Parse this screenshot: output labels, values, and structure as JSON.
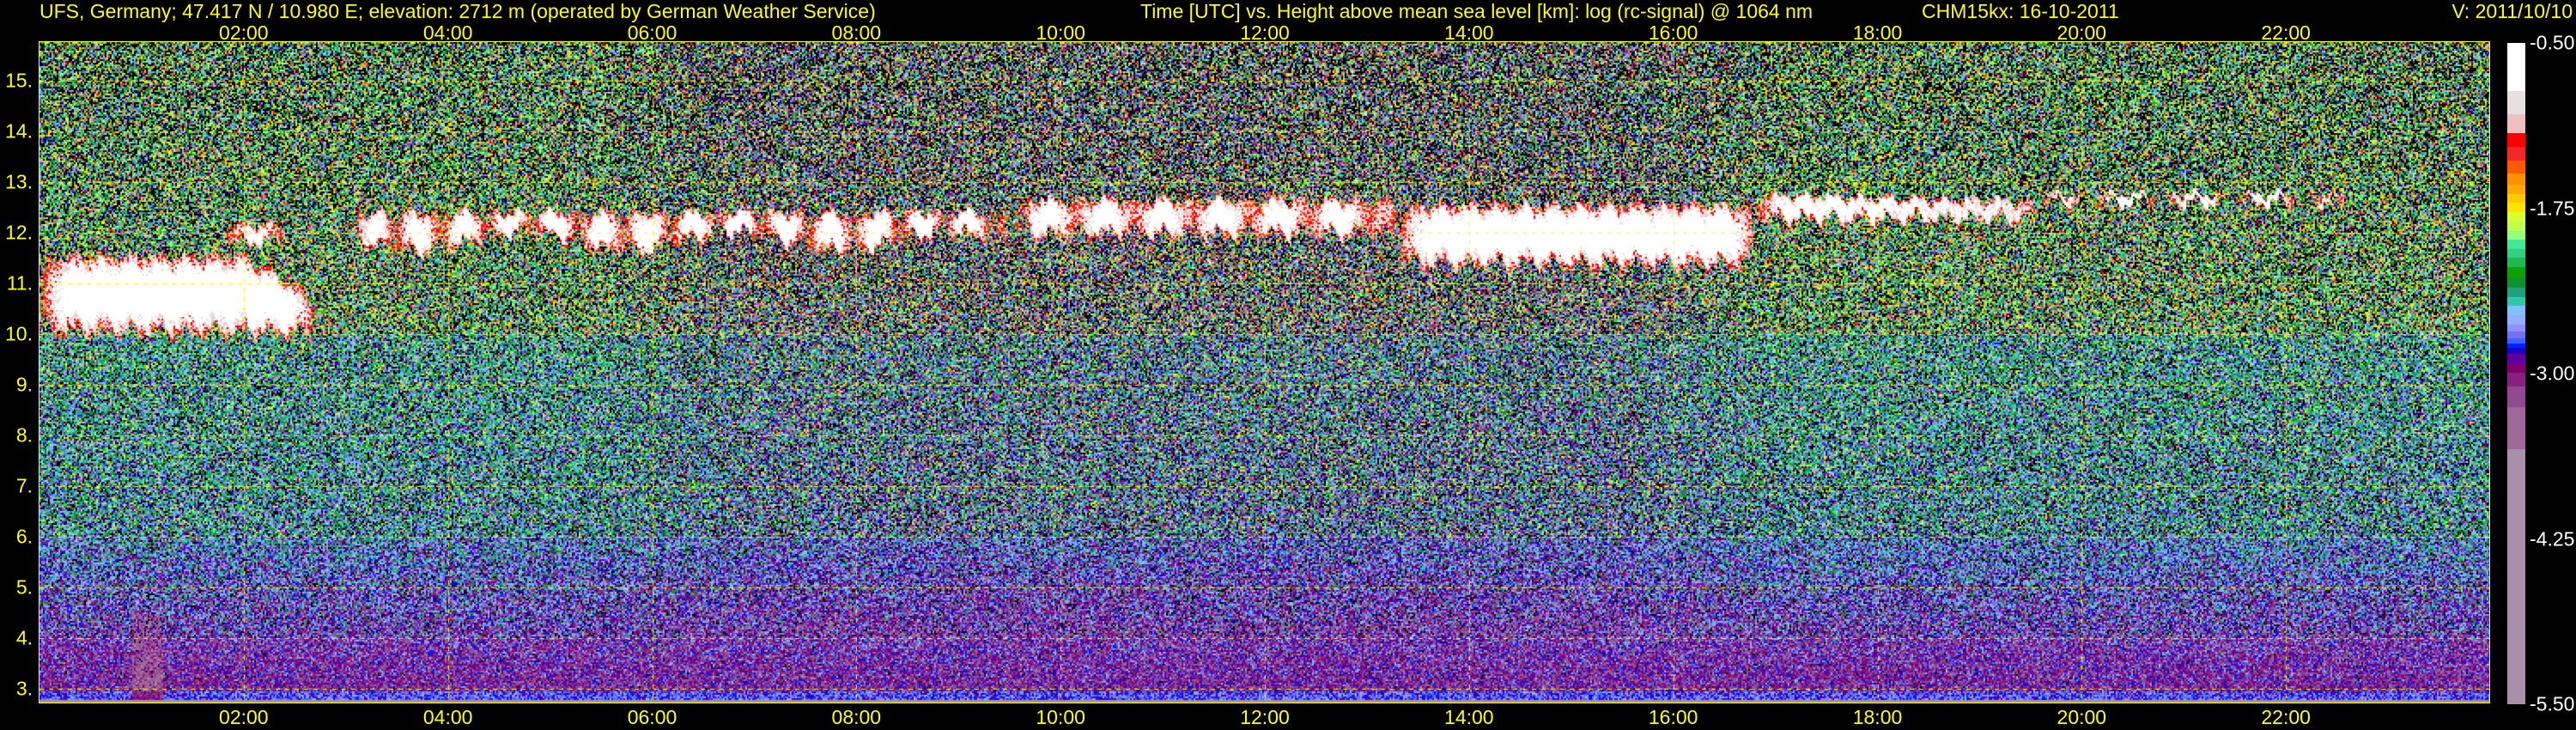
{
  "header": {
    "site": "UFS, Germany; 47.417 N / 10.980 E; elevation: 2712 m  (operated by German Weather Service)",
    "axis_title": "Time [UTC] vs. Height above mean sea level [km]: log (rc-signal) @ 1064 nm",
    "instrument": "CHM15kx: 16-10-2011",
    "version": "V: 2011/10/10"
  },
  "chart_data": {
    "type": "heatmap",
    "title": "Time [UTC] vs. Height above mean sea level [km]: log (rc-signal) @ 1064 nm",
    "xlabel": "Time [UTC]",
    "ylabel": "Height above mean sea level [km]",
    "xlim_hours": [
      0,
      24
    ],
    "ylim_km": [
      2.712,
      15.76
    ],
    "x_ticks": [
      {
        "value": 2,
        "label": "02:00"
      },
      {
        "value": 4,
        "label": "04:00"
      },
      {
        "value": 6,
        "label": "06:00"
      },
      {
        "value": 8,
        "label": "08:00"
      },
      {
        "value": 10,
        "label": "10:00"
      },
      {
        "value": 12,
        "label": "12:00"
      },
      {
        "value": 14,
        "label": "14:00"
      },
      {
        "value": 16,
        "label": "16:00"
      },
      {
        "value": 18,
        "label": "18:00"
      },
      {
        "value": 20,
        "label": "20:00"
      },
      {
        "value": 22,
        "label": "22:00"
      }
    ],
    "y_ticks": [
      {
        "value": 3,
        "label": "3."
      },
      {
        "value": 4,
        "label": "4."
      },
      {
        "value": 5,
        "label": "5."
      },
      {
        "value": 6,
        "label": "6."
      },
      {
        "value": 7,
        "label": "7."
      },
      {
        "value": 8,
        "label": "8."
      },
      {
        "value": 9,
        "label": "9."
      },
      {
        "value": 10,
        "label": "10."
      },
      {
        "value": 11,
        "label": "11."
      },
      {
        "value": 12,
        "label": "12."
      },
      {
        "value": 13,
        "label": "13."
      },
      {
        "value": 14,
        "label": "14."
      },
      {
        "value": 15,
        "label": "15."
      }
    ],
    "grid": true,
    "grid_color": "#ffff00",
    "colorbar": {
      "range": [
        -5.5,
        -0.5
      ],
      "ticks": [
        {
          "value": -0.5,
          "label": "-0.50"
        },
        {
          "value": -1.75,
          "label": "-1.75"
        },
        {
          "value": -3.0,
          "label": "-3.00"
        },
        {
          "value": -4.25,
          "label": "-4.25"
        },
        {
          "value": -5.5,
          "label": "-5.50"
        }
      ],
      "colormap": [
        {
          "min": -0.863,
          "color": "#ffffff"
        },
        {
          "min": -1.039,
          "color": "#e8dfe0"
        },
        {
          "min": -1.18,
          "color": "#f0c0c0"
        },
        {
          "min": -1.285,
          "color": "#ff0000"
        },
        {
          "min": -1.391,
          "color": "#f02828"
        },
        {
          "min": -1.486,
          "color": "#ff5a00"
        },
        {
          "min": -1.574,
          "color": "#ff9000"
        },
        {
          "min": -1.644,
          "color": "#ffa800"
        },
        {
          "min": -1.708,
          "color": "#ffc800"
        },
        {
          "min": -1.778,
          "color": "#ffe400"
        },
        {
          "min": -1.849,
          "color": "#d8ff30"
        },
        {
          "min": -1.919,
          "color": "#c0ff50"
        },
        {
          "min": -1.989,
          "color": "#90ff80"
        },
        {
          "min": -2.06,
          "color": "#40e898"
        },
        {
          "min": -2.123,
          "color": "#30d080"
        },
        {
          "min": -2.194,
          "color": "#20b850"
        },
        {
          "min": -2.271,
          "color": "#10a000"
        },
        {
          "min": -2.349,
          "color": "#109030"
        },
        {
          "min": -2.419,
          "color": "#20a080"
        },
        {
          "min": -2.489,
          "color": "#30c8a8"
        },
        {
          "min": -2.56,
          "color": "#80c0ff"
        },
        {
          "min": -2.63,
          "color": "#90b0ff"
        },
        {
          "min": -2.683,
          "color": "#9090ff"
        },
        {
          "min": -2.736,
          "color": "#7070f0"
        },
        {
          "min": -2.771,
          "color": "#4060ff"
        },
        {
          "min": -2.806,
          "color": "#0020ff"
        },
        {
          "min": -2.852,
          "color": "#2000c0"
        },
        {
          "min": -2.923,
          "color": "#6000a0"
        },
        {
          "min": -2.993,
          "color": "#800070"
        },
        {
          "min": -3.099,
          "color": "#882080"
        },
        {
          "min": -3.25,
          "color": "#904890"
        },
        {
          "min": -3.574,
          "color": "#a06898"
        },
        {
          "min": -5.5,
          "color": "#a890a8"
        }
      ]
    },
    "features": [
      {
        "type": "cloud",
        "time_hours": [
          0,
          2.7
        ],
        "height_km": [
          10.0,
          11.6
        ]
      },
      {
        "type": "cloud",
        "time_hours": [
          3.0,
          9.5
        ],
        "height_km": [
          11.7,
          12.6
        ]
      },
      {
        "type": "cloud",
        "time_hours": [
          9.5,
          13.3
        ],
        "height_km": [
          11.9,
          12.7
        ]
      },
      {
        "type": "cloud",
        "time_hours": [
          13.3,
          16.8
        ],
        "height_km": [
          11.3,
          12.6
        ]
      },
      {
        "type": "cloud",
        "time_hours": [
          16.8,
          22.6
        ],
        "height_km": [
          12.2,
          12.8
        ]
      }
    ]
  }
}
